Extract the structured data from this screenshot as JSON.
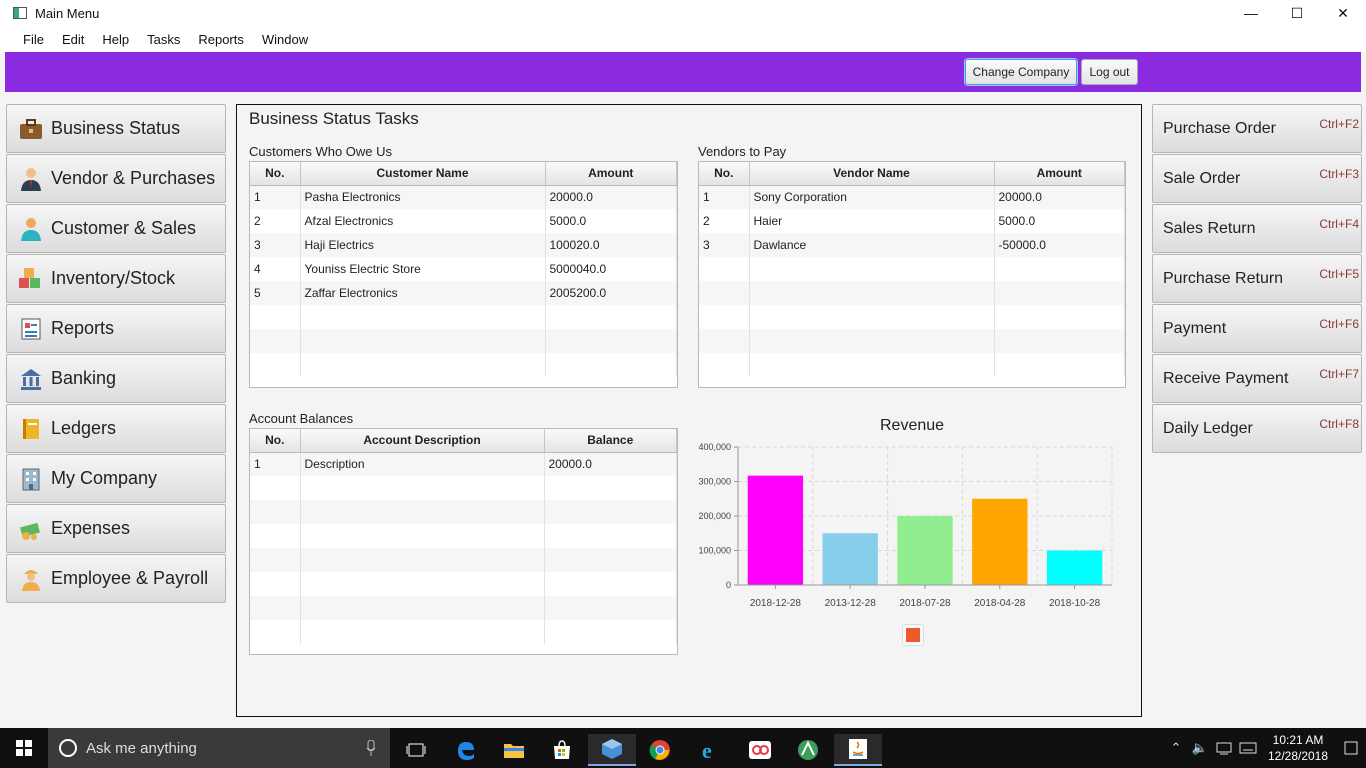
{
  "window": {
    "title": "Main Menu",
    "minimize_glyph": "—",
    "maximize_glyph": "☐",
    "close_glyph": "✕"
  },
  "menu": [
    "File",
    "Edit",
    "Help",
    "Tasks",
    "Reports",
    "Window"
  ],
  "header": {
    "accent_color": "#8a2be2",
    "change_company_label": "Change Company",
    "logout_label": "Log out"
  },
  "sidebar": {
    "items": [
      {
        "label": "Business Status",
        "icon": "briefcase-icon"
      },
      {
        "label": "Vendor & Purchases",
        "icon": "businessman-icon"
      },
      {
        "label": "Customer & Sales",
        "icon": "customer-icon"
      },
      {
        "label": "Inventory/Stock",
        "icon": "boxes-icon"
      },
      {
        "label": "Reports",
        "icon": "report-icon"
      },
      {
        "label": "Banking",
        "icon": "bank-icon"
      },
      {
        "label": "Ledgers",
        "icon": "ledger-book-icon"
      },
      {
        "label": "My Company",
        "icon": "building-icon"
      },
      {
        "label": "Expenses",
        "icon": "money-icon"
      },
      {
        "label": "Employee & Payroll",
        "icon": "worker-icon"
      }
    ]
  },
  "center": {
    "title": "Business Status Tasks",
    "customers": {
      "label": "Customers Who Owe Us",
      "headers": [
        "No.",
        "Customer Name",
        "Amount"
      ],
      "rows": [
        [
          "1",
          "Pasha Electronics",
          "20000.0"
        ],
        [
          "2",
          "Afzal Electronics",
          "5000.0"
        ],
        [
          "3",
          "Haji Electrics",
          "100020.0"
        ],
        [
          "4",
          "Youniss Electric Store",
          "5000040.0"
        ],
        [
          "5",
          "Zaffar Electronics",
          "2005200.0"
        ]
      ]
    },
    "vendors": {
      "label": "Vendors to Pay",
      "headers": [
        "No.",
        "Vendor Name",
        "Amount"
      ],
      "rows": [
        [
          "1",
          "Sony Corporation",
          "20000.0"
        ],
        [
          "2",
          "Haier",
          "5000.0"
        ],
        [
          "3",
          "Dawlance",
          "-50000.0"
        ]
      ]
    },
    "accounts": {
      "label": "Account Balances",
      "headers": [
        "No.",
        "Account Description",
        "Balance"
      ],
      "rows": [
        [
          "1",
          "Description",
          "20000.0"
        ]
      ]
    }
  },
  "chart_data": {
    "type": "bar",
    "title": "Revenue",
    "categories": [
      "2018-12-28",
      "2013-12-28",
      "2018-07-28",
      "2018-04-28",
      "2018-10-28"
    ],
    "values": [
      317000,
      150000,
      200000,
      250000,
      100000
    ],
    "colors": [
      "#ff00ff",
      "#87ceeb",
      "#90ee90",
      "#ffa500",
      "#00ffff"
    ],
    "yticks": [
      "0",
      "100,000",
      "200,000",
      "300,000",
      "400,000"
    ],
    "ylim": [
      0,
      400000
    ],
    "grid": true,
    "legend_color": "#f05a28",
    "legend_placement": "bottom-center"
  },
  "right_panel": {
    "items": [
      {
        "label": "Purchase Order",
        "shortcut": "Ctrl+F2"
      },
      {
        "label": "Sale Order",
        "shortcut": "Ctrl+F3"
      },
      {
        "label": "Sales Return",
        "shortcut": "Ctrl+F4"
      },
      {
        "label": "Purchase Return",
        "shortcut": "Ctrl+F5"
      },
      {
        "label": "Payment",
        "shortcut": "Ctrl+F6"
      },
      {
        "label": "Receive Payment",
        "shortcut": "Ctrl+F7"
      },
      {
        "label": "Daily Ledger",
        "shortcut": "Ctrl+F8"
      }
    ]
  },
  "taskbar": {
    "search_placeholder": "Ask me anything",
    "apps": [
      "task-view-icon",
      "edge-icon",
      "file-explorer-icon",
      "store-icon",
      "virtualbox-icon",
      "chrome-icon",
      "ie-icon",
      "flickr-icon",
      "android-studio-icon",
      "java-icon"
    ],
    "time": "10:21 AM",
    "date": "12/28/2018"
  }
}
